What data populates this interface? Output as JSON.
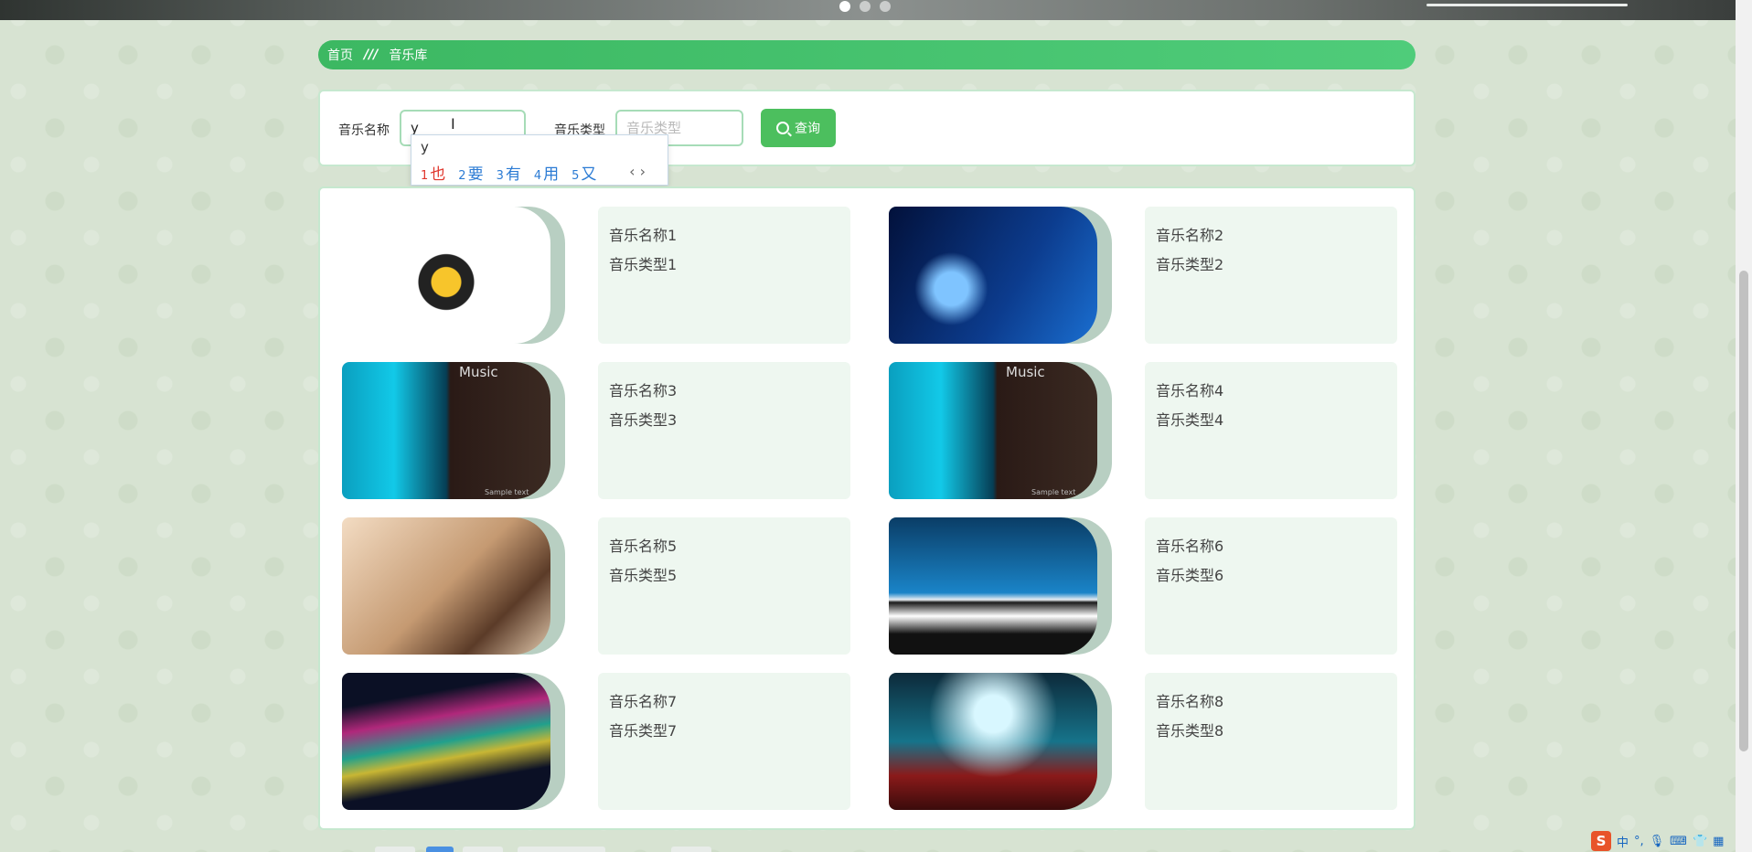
{
  "breadcrumb": {
    "home": "首页",
    "separator": "///",
    "current": "音乐库"
  },
  "search": {
    "name_label": "音乐名称",
    "name_value": "y",
    "type_label": "音乐类型",
    "type_placeholder": "音乐类型",
    "query_button": "查询"
  },
  "ime": {
    "input": "y",
    "candidates": [
      {
        "num": "1",
        "text": "也"
      },
      {
        "num": "2",
        "text": "要"
      },
      {
        "num": "3",
        "text": "有"
      },
      {
        "num": "4",
        "text": "用"
      },
      {
        "num": "5",
        "text": "又"
      }
    ],
    "arrows": "‹ ›"
  },
  "cards": [
    {
      "name": "音乐名称1",
      "type": "音乐类型1"
    },
    {
      "name": "音乐名称2",
      "type": "音乐类型2"
    },
    {
      "name": "音乐名称3",
      "type": "音乐类型3"
    },
    {
      "name": "音乐名称4",
      "type": "音乐类型4"
    },
    {
      "name": "音乐名称5",
      "type": "音乐类型5"
    },
    {
      "name": "音乐名称6",
      "type": "音乐类型6"
    },
    {
      "name": "音乐名称7",
      "type": "音乐类型7"
    },
    {
      "name": "音乐名称8",
      "type": "音乐类型8"
    }
  ],
  "image_text": {
    "music": "Music",
    "sample": "Sample text"
  },
  "tray": {
    "logo": "S",
    "lang": "中"
  },
  "colors": {
    "accent": "#4cbf5e",
    "breadcrumb": "#3cb862",
    "card_bg": "#eef7f0"
  }
}
